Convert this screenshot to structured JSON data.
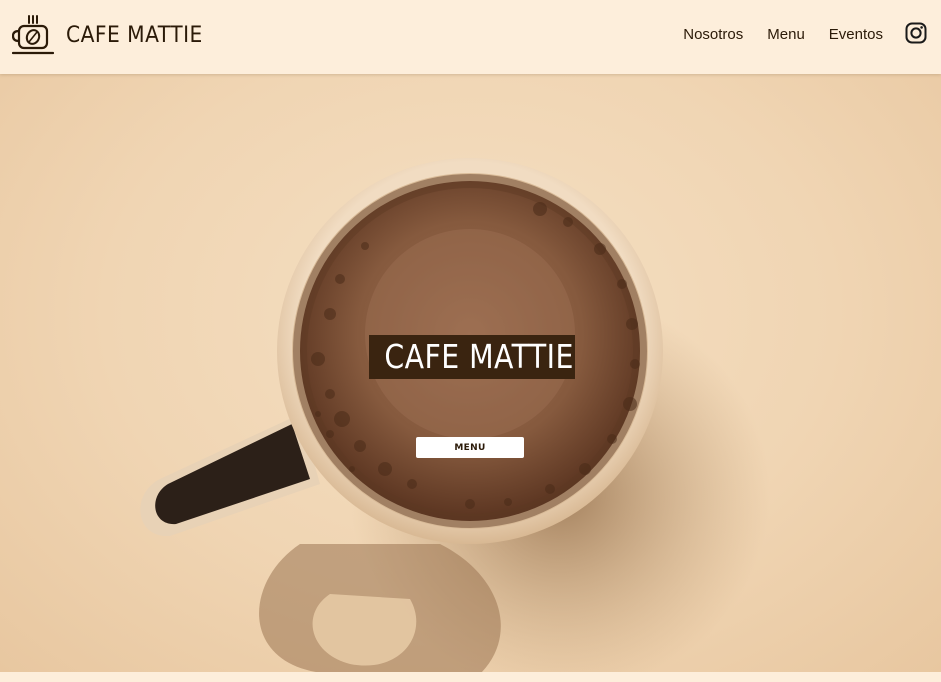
{
  "header": {
    "brand_name": "CAFE MATTIE",
    "logo_icon": "coffee-cup-icon",
    "nav": [
      {
        "label": "Nosotros"
      },
      {
        "label": "Menu"
      },
      {
        "label": "Eventos"
      }
    ],
    "social_icon": "instagram-icon"
  },
  "hero": {
    "title": "CAFE MATTIE",
    "menu_button_label": "MENU",
    "background_image": "coffee-mug-top-view"
  },
  "colors": {
    "header_bg": "#fdeedb",
    "text_dark": "#2b1a08",
    "title_bg": "#3a2410",
    "button_bg": "#ffffff"
  }
}
